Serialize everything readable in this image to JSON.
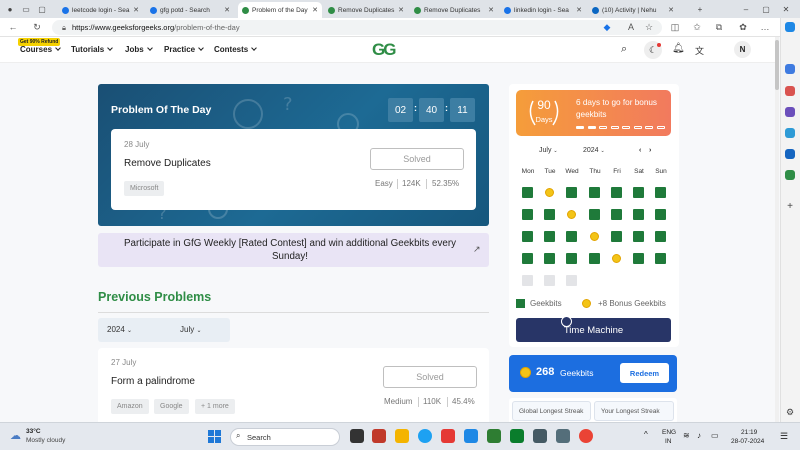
{
  "browser": {
    "tabs": [
      {
        "label": "leetcode login - Sea",
        "active": false
      },
      {
        "label": "gfg potd - Search",
        "active": false
      },
      {
        "label": "Problem of the Day",
        "active": true
      },
      {
        "label": "Remove Duplicates",
        "active": false
      },
      {
        "label": "Remove Duplicates",
        "active": false
      },
      {
        "label": "linkedin login - Sea",
        "active": false
      },
      {
        "label": "(10) Activity | Nehu",
        "active": false
      }
    ],
    "url_domain": "https://www.geeksforgeeks.org",
    "url_path": "/problem-of-the-day"
  },
  "nav": {
    "refund_badge": "Get 90% Refund",
    "courses": "Courses",
    "tutorials": "Tutorials",
    "jobs": "Jobs",
    "practice": "Practice",
    "contests": "Contests",
    "logo": "GG",
    "avatar": "N"
  },
  "potd": {
    "title": "Problem Of The Day",
    "timer_h": "02",
    "timer_m": "40",
    "timer_s": "11",
    "date": "28 July",
    "problem": "Remove Duplicates",
    "status": "Solved",
    "tag": "Microsoft",
    "difficulty": "Easy",
    "submissions": "124K",
    "accuracy": "52.35%"
  },
  "banner": {
    "text": "Participate in GfG Weekly [Rated Contest] and win additional Geekbits every Sunday!"
  },
  "previous": {
    "title": "Previous Problems",
    "year": "2024",
    "month": "July",
    "card": {
      "date": "27 July",
      "problem": "Form a palindrome",
      "status": "Solved",
      "tags": [
        "Amazon",
        "Google",
        "+ 1 more"
      ],
      "difficulty": "Medium",
      "submissions": "110K",
      "accuracy": "45.4%"
    }
  },
  "streak": {
    "days": "90",
    "days_label": "Days",
    "text": "6 days to go for bonus geekbits",
    "progress_dots": 8,
    "progress_filled": 2
  },
  "calendar": {
    "month": "July",
    "year": "2024",
    "day_headers": [
      "Mon",
      "Tue",
      "Wed",
      "Thu",
      "Fri",
      "Sat",
      "Sun"
    ],
    "rows": [
      [
        "g",
        "c",
        "g",
        "g",
        "g",
        "g",
        "g"
      ],
      [
        "g",
        "g",
        "c",
        "g",
        "g",
        "g",
        "g"
      ],
      [
        "g",
        "g",
        "g",
        "c",
        "g",
        "g",
        "g"
      ],
      [
        "g",
        "g",
        "g",
        "g",
        "c",
        "g",
        "g"
      ],
      [
        "e",
        "e",
        "e",
        "",
        "",
        "",
        ""
      ]
    ],
    "legend_geekbits": "Geekbits",
    "legend_bonus": "+8 Bonus Geekbits",
    "time_machine": "Time Machine"
  },
  "geekbits": {
    "count": "268",
    "label": "Geekbits",
    "redeem": "Redeem"
  },
  "streaks_row": {
    "global": "Global Longest Streak",
    "yours": "Your Longest Streak"
  },
  "taskbar": {
    "temp": "33°C",
    "weather": "Mostly cloudy",
    "search": "Search",
    "lang": "ENG",
    "region": "IN",
    "time": "21:19",
    "date": "28-07-2024"
  },
  "colors": {
    "gfg_green": "#2f8d46",
    "potd_blue": "#1d6a94",
    "time_machine": "#283567",
    "geekbits_blue": "#1c6ee0"
  }
}
